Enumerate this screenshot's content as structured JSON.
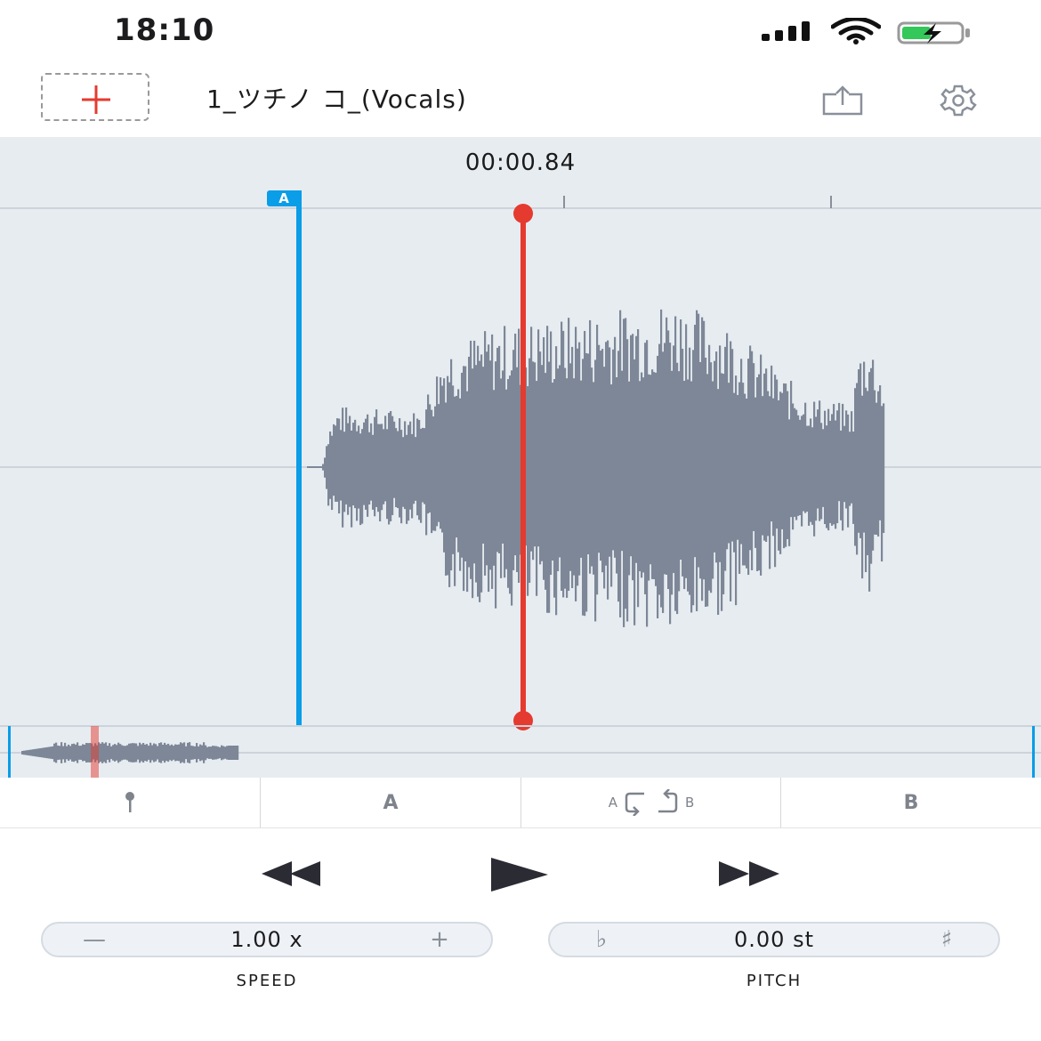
{
  "status": {
    "time": "18:10"
  },
  "header": {
    "title": "1_ツチノ コ_(Vocals)"
  },
  "player": {
    "position": "00:00.84",
    "marker_a_label": "A"
  },
  "ab_bar": {
    "pin_icon": "pin-icon",
    "a_label": "A",
    "loop_left": "A",
    "loop_right": "B",
    "b_label": "B"
  },
  "transport": {
    "rewind": "rewind-icon",
    "play": "play-icon",
    "forward": "fast-forward-icon"
  },
  "speed": {
    "value": "1.00 x",
    "minus": "—",
    "plus": "+",
    "caption": "SPEED"
  },
  "pitch": {
    "value": "0.00 st",
    "flat": "♭",
    "sharp": "♯",
    "caption": "PITCH"
  },
  "colors": {
    "accent_red": "#e53a2f",
    "marker_blue": "#0a9de8",
    "waveform": "#7d8797",
    "background": "#e7ecf1"
  }
}
